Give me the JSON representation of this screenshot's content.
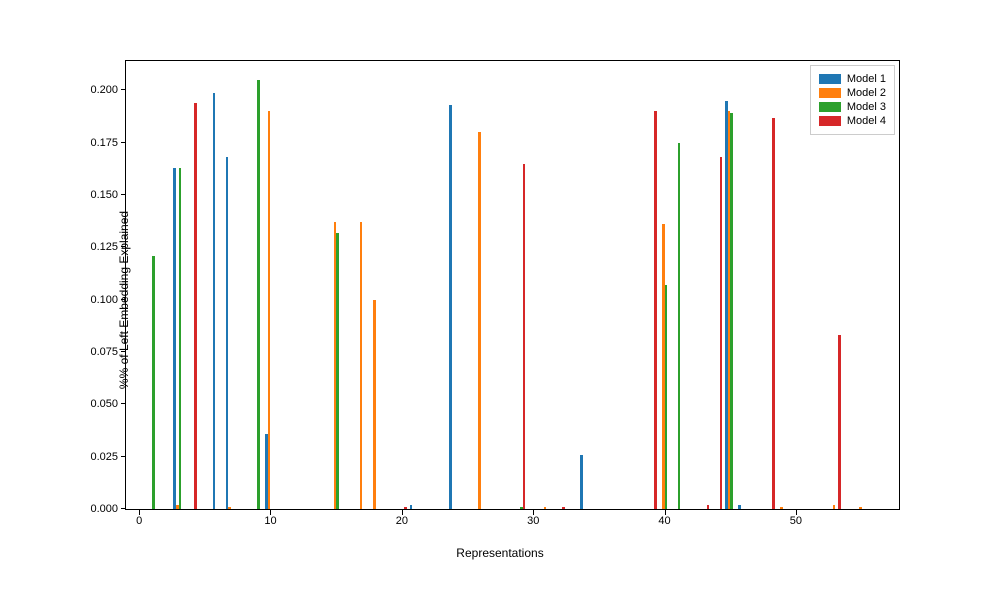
{
  "chart_data": {
    "type": "bar",
    "xlabel": "Representations",
    "ylabel": "%% of Left Embedding Explained",
    "xlim": [
      -1,
      58
    ],
    "ylim": [
      0,
      0.215
    ],
    "x_ticks": [
      0,
      10,
      20,
      30,
      40,
      50
    ],
    "y_ticks": [
      0.0,
      0.025,
      0.05,
      0.075,
      0.1,
      0.125,
      0.15,
      0.175,
      0.2
    ],
    "y_tick_labels": [
      "0.000",
      "0.025",
      "0.050",
      "0.075",
      "0.100",
      "0.125",
      "0.150",
      "0.175",
      "0.200"
    ],
    "series": [
      {
        "name": "Model 1",
        "color": "#1f77b4",
        "offset": -0.3,
        "bars": [
          {
            "x": 3,
            "y": 0.163
          },
          {
            "x": 6,
            "y": 0.199
          },
          {
            "x": 7,
            "y": 0.168
          },
          {
            "x": 10,
            "y": 0.036
          },
          {
            "x": 21,
            "y": 0.002
          },
          {
            "x": 24,
            "y": 0.193
          },
          {
            "x": 34,
            "y": 0.026
          },
          {
            "x": 45,
            "y": 0.195
          },
          {
            "x": 46,
            "y": 0.002
          }
        ]
      },
      {
        "name": "Model 2",
        "color": "#ff7f0e",
        "offset": -0.1,
        "bars": [
          {
            "x": 3,
            "y": 0.002
          },
          {
            "x": 7,
            "y": 0.001
          },
          {
            "x": 10,
            "y": 0.19
          },
          {
            "x": 15,
            "y": 0.137
          },
          {
            "x": 17,
            "y": 0.137
          },
          {
            "x": 18,
            "y": 0.1
          },
          {
            "x": 26,
            "y": 0.18
          },
          {
            "x": 31,
            "y": 0.001
          },
          {
            "x": 40,
            "y": 0.136
          },
          {
            "x": 45,
            "y": 0.19
          },
          {
            "x": 49,
            "y": 0.001
          },
          {
            "x": 53,
            "y": 0.002
          },
          {
            "x": 55,
            "y": 0.001
          }
        ]
      },
      {
        "name": "Model 3",
        "color": "#2ca02c",
        "offset": 0.1,
        "bars": [
          {
            "x": 1,
            "y": 0.121
          },
          {
            "x": 3,
            "y": 0.163
          },
          {
            "x": 9,
            "y": 0.205
          },
          {
            "x": 15,
            "y": 0.132
          },
          {
            "x": 29,
            "y": 0.001
          },
          {
            "x": 40,
            "y": 0.107
          },
          {
            "x": 41,
            "y": 0.175
          },
          {
            "x": 45,
            "y": 0.189
          }
        ]
      },
      {
        "name": "Model 4",
        "color": "#d62728",
        "offset": 0.3,
        "bars": [
          {
            "x": 4,
            "y": 0.194
          },
          {
            "x": 20,
            "y": 0.001
          },
          {
            "x": 29,
            "y": 0.165
          },
          {
            "x": 32,
            "y": 0.001
          },
          {
            "x": 39,
            "y": 0.19
          },
          {
            "x": 43,
            "y": 0.002
          },
          {
            "x": 44,
            "y": 0.168
          },
          {
            "x": 48,
            "y": 0.187
          },
          {
            "x": 53,
            "y": 0.083
          }
        ]
      }
    ]
  }
}
